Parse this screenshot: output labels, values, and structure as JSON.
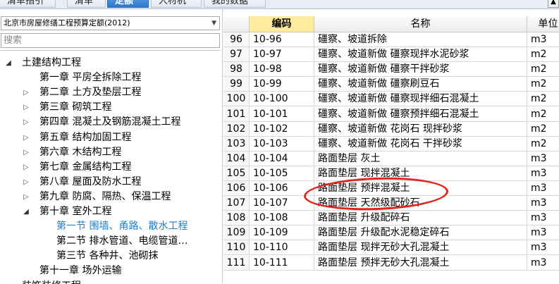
{
  "tabs": [
    {
      "label": "清单指引",
      "active": false
    },
    {
      "label": "清单",
      "active": false
    },
    {
      "label": "定额",
      "active": true
    },
    {
      "label": "人材机",
      "active": false
    },
    {
      "label": "我的数据",
      "active": false
    }
  ],
  "tab_scroll_icon": "up-arrow-icon",
  "library": {
    "selected": "北京市房屋修缮工程预算定额(2012)",
    "dropdown_icon": "chevron-down-icon"
  },
  "search": {
    "placeholder": "搜索",
    "value": ""
  },
  "tree": [
    {
      "label": "土建结构工程",
      "level": 0,
      "toggle": "open",
      "selected": false
    },
    {
      "label": "第一章  平房全拆除工程",
      "level": 1,
      "toggle": "none",
      "selected": false
    },
    {
      "label": "第二章  土方及垫层工程",
      "level": 1,
      "toggle": "closed",
      "selected": false
    },
    {
      "label": "第三章  砌筑工程",
      "level": 1,
      "toggle": "closed",
      "selected": false
    },
    {
      "label": "第四章  混凝土及钢筋混凝土工程",
      "level": 1,
      "toggle": "closed",
      "selected": false
    },
    {
      "label": "第五章  结构加固工程",
      "level": 1,
      "toggle": "closed",
      "selected": false
    },
    {
      "label": "第六章  木结构工程",
      "level": 1,
      "toggle": "closed",
      "selected": false
    },
    {
      "label": "第七章  金属结构工程",
      "level": 1,
      "toggle": "closed",
      "selected": false
    },
    {
      "label": "第八章  屋面及防水工程",
      "level": 1,
      "toggle": "closed",
      "selected": false
    },
    {
      "label": "第九章  防腐、隔热、保温工程",
      "level": 1,
      "toggle": "closed",
      "selected": false
    },
    {
      "label": "第十章  室外工程",
      "level": 1,
      "toggle": "open",
      "selected": false
    },
    {
      "label": "第一节  围墙、甬路、散水工程",
      "level": 2,
      "toggle": "none",
      "selected": true
    },
    {
      "label": "第二节  排水管道、电缆管道…",
      "level": 2,
      "toggle": "none",
      "selected": false
    },
    {
      "label": "第三节  各种井、池砌抹",
      "level": 2,
      "toggle": "none",
      "selected": false
    },
    {
      "label": "第十一章  场外运输",
      "level": 1,
      "toggle": "none",
      "selected": false
    },
    {
      "label": "装饰装修工程",
      "level": 0,
      "toggle": "closed",
      "selected": false
    }
  ],
  "grid": {
    "columns": {
      "code": "编码",
      "name": "名称",
      "unit": "单位"
    },
    "rows": [
      {
        "num": "96",
        "code": "10-96",
        "name": "礓察、坡道拆除",
        "unit": "m3"
      },
      {
        "num": "97",
        "code": "10-97",
        "name": "礓察、坡道新做  礓察现拌水泥砂浆",
        "unit": "m2"
      },
      {
        "num": "98",
        "code": "10-98",
        "name": "礓察、坡道新做  礓察干拌砂浆",
        "unit": "m2"
      },
      {
        "num": "99",
        "code": "10-99",
        "name": "礓察、坡道新做  礓察刷豆石",
        "unit": "m2"
      },
      {
        "num": "100",
        "code": "10-100",
        "name": "礓察、坡道新做  礓察现拌细石混凝土",
        "unit": "m2"
      },
      {
        "num": "101",
        "code": "10-101",
        "name": "礓察、坡道新做  礓察预拌细石混凝土",
        "unit": "m2"
      },
      {
        "num": "102",
        "code": "10-102",
        "name": "礓察、坡道新做  花岗石  现拌砂浆",
        "unit": "m2"
      },
      {
        "num": "103",
        "code": "10-103",
        "name": "礓察、坡道新做  花岗石  干拌砂浆",
        "unit": "m2"
      },
      {
        "num": "104",
        "code": "10-104",
        "name": "路面垫层  灰土",
        "unit": "m3"
      },
      {
        "num": "105",
        "code": "10-105",
        "name": "路面垫层  现拌混凝土",
        "unit": "m3"
      },
      {
        "num": "106",
        "code": "10-106",
        "name": "路面垫层  预拌混凝土",
        "unit": "m3"
      },
      {
        "num": "107",
        "code": "10-107",
        "name": "路面垫层  天然级配砂石",
        "unit": "m3"
      },
      {
        "num": "108",
        "code": "10-108",
        "name": "路面垫层  升级配碎石",
        "unit": "m3"
      },
      {
        "num": "109",
        "code": "10-109",
        "name": "路面垫层  升级配水泥稳定碎石",
        "unit": "m3"
      },
      {
        "num": "110",
        "code": "10-110",
        "name": "路面垫层  现拌无砂大孔混凝土",
        "unit": "m3"
      },
      {
        "num": "111",
        "code": "10-111",
        "name": "路面垫层  预拌无砂大孔混凝土",
        "unit": "m3"
      }
    ]
  },
  "annotation_color": "#e0251d",
  "accent_color": "#1b7fd8"
}
